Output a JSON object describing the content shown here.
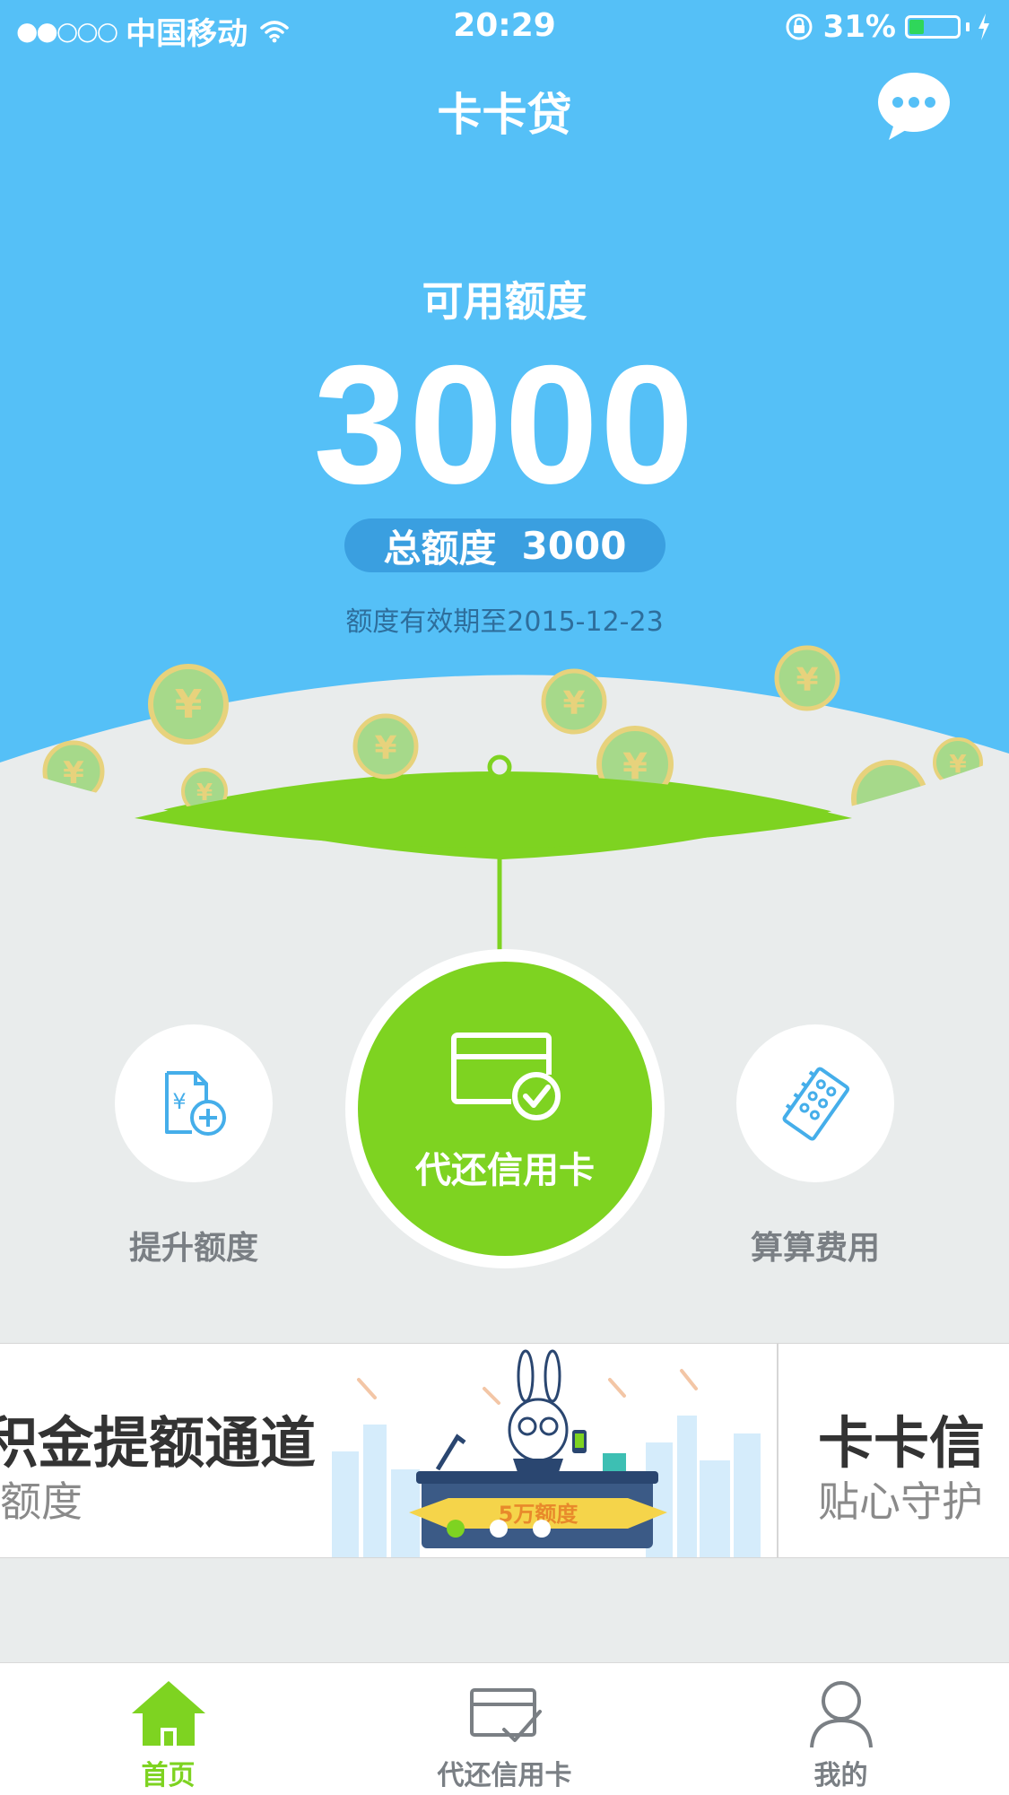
{
  "status_bar": {
    "signal": "●●○○○",
    "carrier": "中国移动",
    "time": "20:29",
    "battery_percent": "31%",
    "battery_level": 0.31,
    "icons": [
      "wifi-icon",
      "rotation-lock-icon",
      "battery-icon",
      "charging-icon"
    ]
  },
  "nav": {
    "title": "卡卡贷",
    "chat_icon": "chat-bubble-icon"
  },
  "credit": {
    "available_label": "可用额度",
    "available_value": "3000",
    "total_label": "总额度",
    "total_value": "3000",
    "expiry_text": "额度有效期至2015-12-23"
  },
  "actions": {
    "left": {
      "label": "提升额度",
      "icon": "document-yuan-plus-icon"
    },
    "center": {
      "label": "代还信用卡",
      "icon": "card-check-icon"
    },
    "right": {
      "label": "算算费用",
      "icon": "receipt-calculator-icon"
    }
  },
  "banners": [
    {
      "title": "积金提额通道",
      "subtitle": "额度",
      "art_text": "5万额度"
    },
    {
      "title": "卡卡信",
      "subtitle": "贴心守护"
    }
  ],
  "carousel": {
    "active_index": 0,
    "count": 3
  },
  "tabbar": {
    "items": [
      {
        "label": "首页",
        "icon": "home-icon",
        "active": true
      },
      {
        "label": "代还信用卡",
        "icon": "card-check-icon",
        "active": false
      },
      {
        "label": "我的",
        "icon": "user-icon",
        "active": false
      }
    ]
  },
  "colors": {
    "primary_blue": "#55c0f7",
    "accent_green": "#7ed321",
    "pill_blue": "#3a9fe0",
    "background": "#e9ecec"
  }
}
